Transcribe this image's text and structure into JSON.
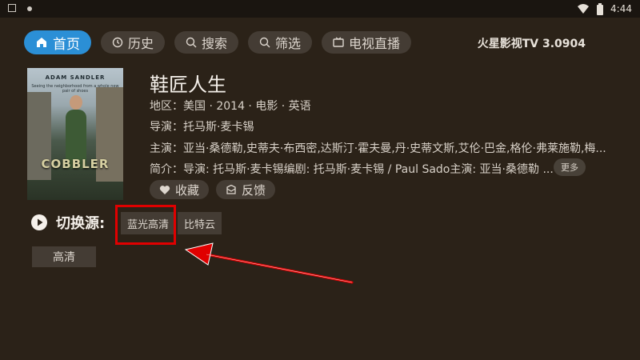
{
  "status_bar": {
    "time": "4:44",
    "icons": [
      "sim-icon",
      "notification-dot-icon",
      "wifi-icon",
      "battery-icon"
    ]
  },
  "nav": {
    "items": [
      {
        "label": "首页",
        "icon": "home-icon",
        "active": true
      },
      {
        "label": "历史",
        "icon": "clock-icon"
      },
      {
        "label": "搜索",
        "icon": "search-icon"
      },
      {
        "label": "筛选",
        "icon": "filter-icon"
      },
      {
        "label": "电视直播",
        "icon": "tv-icon"
      }
    ],
    "app_version": "火星影视TV 3.0904"
  },
  "movie": {
    "poster": {
      "actor": "ADAM SANDLER",
      "tagline": "Seeing the neighborhood from a whole new pair of shoes",
      "title": "COBBLER"
    },
    "title": "鞋匠人生",
    "region_line": "地区：美国 · 2014 · 电影 · 英语",
    "director_line": "导演：托马斯·麦卡锡",
    "cast_line": "主演：亚当·桑德勒,史蒂夫·布西密,达斯汀·霍夫曼,丹·史蒂文斯,艾伦·巴金,格伦·弗莱施勒,梅...",
    "summary_line": "简介：导演: 托马斯·麦卡锡编剧: 托马斯·麦卡锡 / Paul Sado主演: 亚当·桑德勒 ...",
    "more_label": "更多",
    "favorite_label": "收藏",
    "feedback_label": "反馈"
  },
  "sources": {
    "label": "切换源:",
    "items": [
      "蓝光高清",
      "比特云"
    ],
    "quality": "高清"
  },
  "colors": {
    "background": "#2b2218",
    "accent": "#2b8fd6",
    "highlight": "#e00000"
  }
}
